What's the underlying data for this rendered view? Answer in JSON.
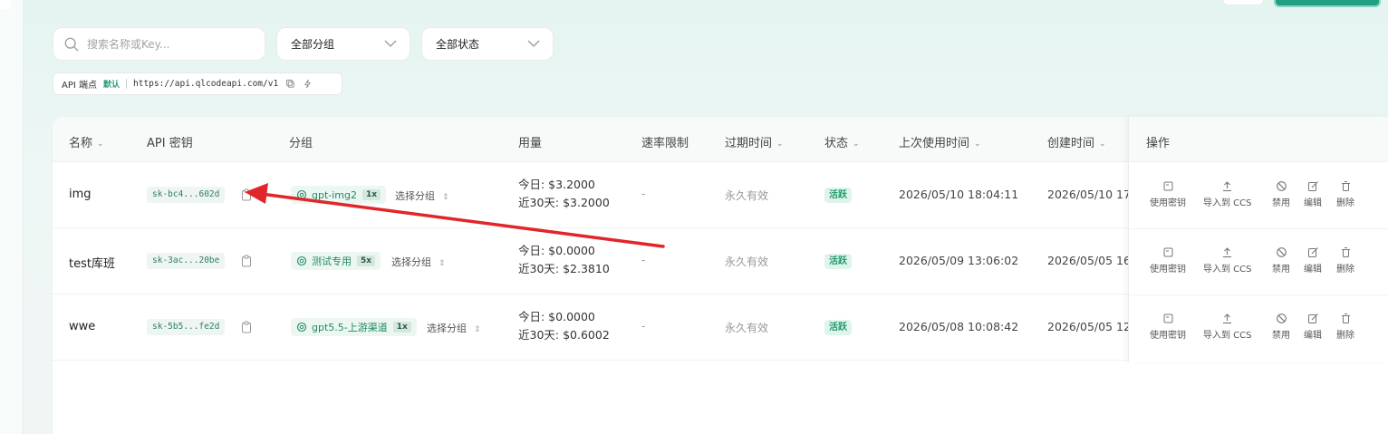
{
  "toolbar": {
    "search_placeholder": "搜索名称或Key...",
    "group_filter": "全部分组",
    "status_filter": "全部状态"
  },
  "endpoint": {
    "label": "API 端点",
    "default_tag": "默认",
    "url": "https://api.qlcodeapi.com/v1"
  },
  "table": {
    "headers": {
      "name": "名称",
      "key": "API 密钥",
      "group": "分组",
      "usage": "用量",
      "rate_limit": "速率限制",
      "expire": "过期时间",
      "status": "状态",
      "last_used": "上次使用时间",
      "created": "创建时间",
      "actions": "操作"
    },
    "rows": [
      {
        "name": "img",
        "key": "sk-bc4...602d",
        "group": "gpt-img2",
        "multiplier": "1x",
        "group_select": "选择分组",
        "usage_today": "今日: $3.2000",
        "usage_30d": "近30天: $3.2000",
        "rate_limit": "-",
        "expire": "永久有效",
        "status": "活跃",
        "last_used": "2026/05/10 18:04:11",
        "created": "2026/05/10 17"
      },
      {
        "name": "test库班",
        "key": "sk-3ac...20be",
        "group": "测试专用",
        "multiplier": "5x",
        "group_select": "选择分组",
        "usage_today": "今日: $0.0000",
        "usage_30d": "近30天: $2.3810",
        "rate_limit": "-",
        "expire": "永久有效",
        "status": "活跃",
        "last_used": "2026/05/09 13:06:02",
        "created": "2026/05/05 16"
      },
      {
        "name": "wwe",
        "key": "sk-5b5...fe2d",
        "group": "gpt5.5-上游渠道",
        "multiplier": "1x",
        "group_select": "选择分组",
        "usage_today": "今日: $0.0000",
        "usage_30d": "近30天: $0.6002",
        "rate_limit": "-",
        "expire": "永久有效",
        "status": "活跃",
        "last_used": "2026/05/08 10:08:42",
        "created": "2026/05/05 12"
      }
    ],
    "actions": {
      "use_key": "使用密钥",
      "import_ccs": "导入到 CCS",
      "disable": "禁用",
      "edit": "编辑",
      "delete": "删除"
    }
  },
  "colors": {
    "accent": "#20a082",
    "status_active_bg": "#dff4ea",
    "arrow": "#e0262b"
  }
}
